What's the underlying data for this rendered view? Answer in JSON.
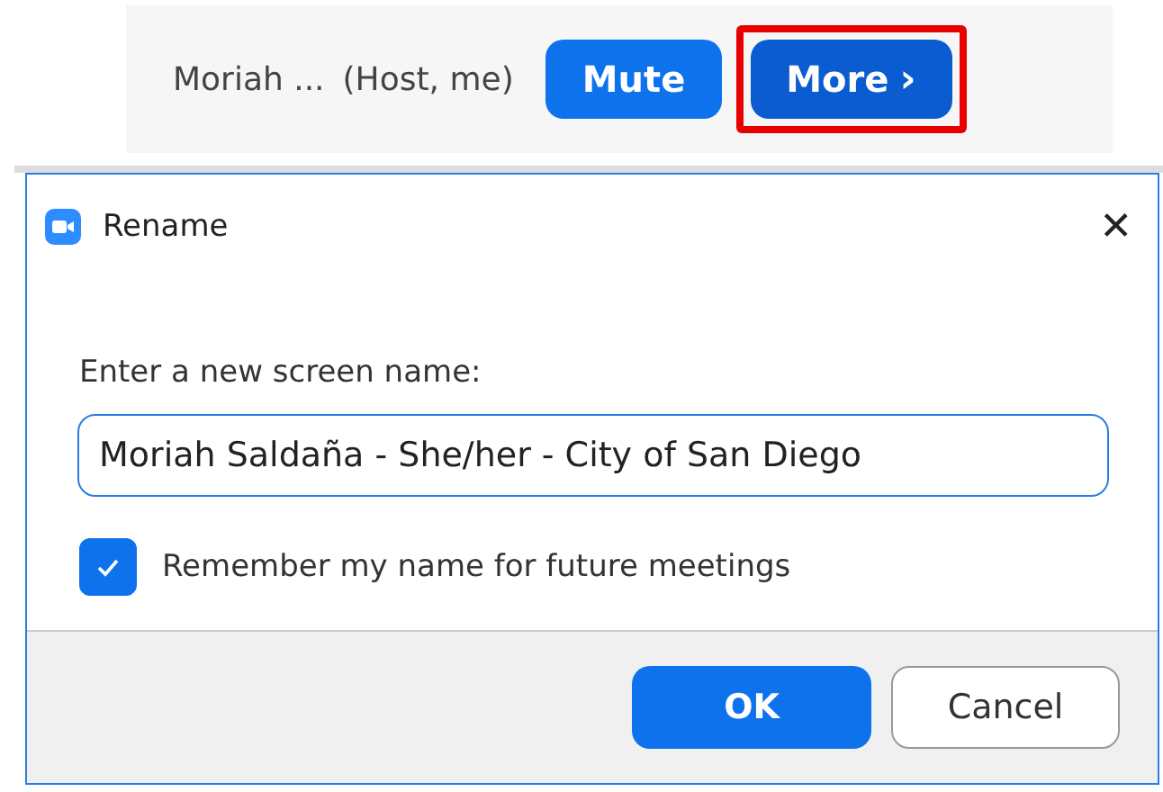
{
  "participant_row": {
    "name": "Moriah ...",
    "role": "(Host, me)",
    "buttons": [
      {
        "label": "Mute",
        "highlighted": false
      },
      {
        "label": "More",
        "chevron": "›",
        "highlighted": true
      }
    ]
  },
  "dialog": {
    "title": "Rename",
    "close": "✕",
    "prompt": "Enter a new screen name:",
    "name_value": "Moriah Saldaña - She/her - City of San Diego",
    "remember": {
      "label": "Remember my name for future meetings",
      "checked": true
    },
    "buttons": [
      {
        "label": "OK",
        "kind": "primary"
      },
      {
        "label": "Cancel",
        "kind": "secondary"
      }
    ]
  }
}
